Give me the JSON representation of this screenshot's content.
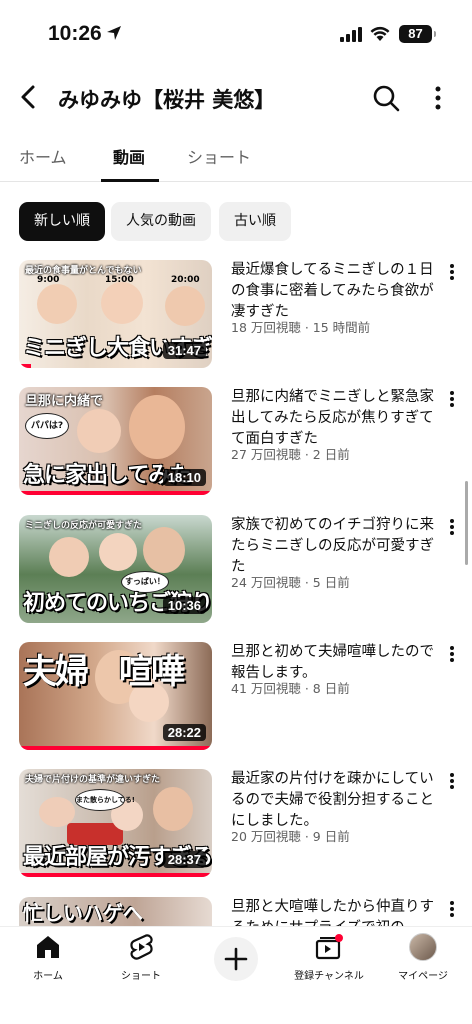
{
  "status_bar": {
    "time": "10:26",
    "battery": "87"
  },
  "header": {
    "channel_title": "みゆみゆ【桜井 美悠】"
  },
  "tabs": [
    {
      "label": "ホーム",
      "active": false
    },
    {
      "label": "動画",
      "active": true
    },
    {
      "label": "ショート",
      "active": false
    }
  ],
  "chips": [
    {
      "label": "新しい順",
      "selected": true
    },
    {
      "label": "人気の動画",
      "selected": false
    },
    {
      "label": "古い順",
      "selected": false
    }
  ],
  "videos": [
    {
      "title": "最近爆食してるミニぎしの１日の食事に密着してみたら食欲が凄すぎた",
      "meta": "18 万回視聴 · 15 時間前",
      "duration": "31:47",
      "thumb_top_text": "最近の食事量がとんでもない",
      "thumb_big_text": "ミニぎし大食いすぎる",
      "thumb_labels": [
        "9:00",
        "15:00",
        "20:00"
      ],
      "watched_fraction": 0.06
    },
    {
      "title": "旦那に内緒でミニぎしと緊急家出してみたら反応が焦りすぎてて面白すぎた",
      "meta": "27 万回視聴 · 2 日前",
      "duration": "18:10",
      "thumb_top_text": "旦那に内緒で",
      "thumb_big_text": "急に家出してみた",
      "thumb_bubble": "パパは?",
      "watched_fraction": 1.0
    },
    {
      "title": "家族で初めてのイチゴ狩りに来たらミニぎしの反応が可愛すぎた",
      "meta": "24 万回視聴 · 5 日前",
      "duration": "10:36",
      "thumb_top_text": "ミニぎしの反応が可愛すぎた",
      "thumb_big_text": "初めてのいちご狩り",
      "thumb_bubble": "すっぱい！",
      "watched_fraction": 0
    },
    {
      "title": "旦那と初めて夫婦喧嘩したので報告します。",
      "meta": "41 万回視聴 · 8 日前",
      "duration": "28:22",
      "thumb_top_text": "",
      "thumb_big_text": "夫婦　喧嘩",
      "watched_fraction": 1.0
    },
    {
      "title": "最近家の片付けを疎かにしているので夫婦で役割分担することにしました。",
      "meta": "20 万回視聴 · 9 日前",
      "duration": "28:37",
      "thumb_top_text": "夫婦で片付けの基準が違いすぎた",
      "thumb_big_text": "最近部屋が汚すぎる",
      "thumb_bubble": "また散らかしてる!",
      "watched_fraction": 1.0
    },
    {
      "title": "旦那と大喧嘩したから仲直りするためにサプライズで初の",
      "meta": "",
      "duration": "",
      "thumb_top_text": "",
      "thumb_big_text": "忙しいハゲへ",
      "watched_fraction": 0
    }
  ],
  "bottom_nav": [
    {
      "label": "ホーム",
      "icon": "home-icon"
    },
    {
      "label": "ショート",
      "icon": "shorts-icon"
    },
    {
      "label": "",
      "icon": "create-icon"
    },
    {
      "label": "登録チャンネル",
      "icon": "subscriptions-icon"
    },
    {
      "label": "マイページ",
      "icon": "avatar"
    }
  ],
  "colors": {
    "accent_red": "#ff0033",
    "chip_selected": "#0f0f0f",
    "chip": "#f0f0f0"
  }
}
